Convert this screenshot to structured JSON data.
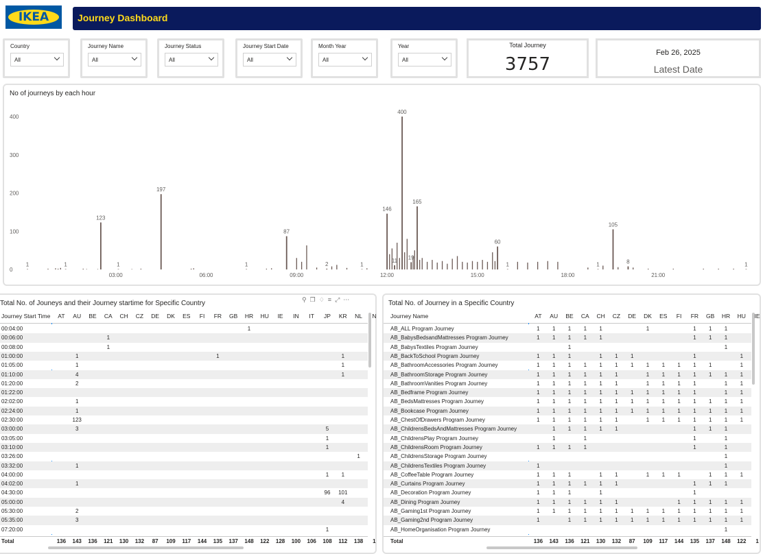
{
  "header": {
    "logo_text": "IKEA",
    "title": "Journey Dashboard"
  },
  "filters": [
    {
      "label": "Country",
      "value": "All"
    },
    {
      "label": "Journey Name",
      "value": "All"
    },
    {
      "label": "Journey Status",
      "value": "All"
    },
    {
      "label": "Journey Start Date",
      "value": "All"
    },
    {
      "label": "Month Year",
      "value": "All"
    },
    {
      "label": "Year",
      "value": "All"
    }
  ],
  "total_card": {
    "title": "Total Journey",
    "value": "3757"
  },
  "date_card": {
    "date": "Feb 26, 2025",
    "label": "Latest Date"
  },
  "colors": {
    "header_bg": "#0a1a5c",
    "header_text": "#ffda1a",
    "logo_blue": "#0058a3",
    "logo_yellow": "#ffda1a",
    "bar": "#6b5a55"
  },
  "chart_data": {
    "type": "bar",
    "title": "No of journeys by each hour",
    "x_tick_labels": [
      "03:00",
      "06:00",
      "09:00",
      "12:00",
      "15:00",
      "18:00",
      "21:00"
    ],
    "y_tick_labels": [
      "0",
      "100",
      "200",
      "300",
      "400"
    ],
    "ylim": [
      0,
      400
    ],
    "x_range_hours": [
      0,
      24
    ],
    "labeled_bars": [
      {
        "x": "00:04",
        "value": 1
      },
      {
        "x": "01:20",
        "value": 1
      },
      {
        "x": "02:30",
        "value": 123
      },
      {
        "x": "03:05",
        "value": 1
      },
      {
        "x": "04:30",
        "value": 197
      },
      {
        "x": "07:20",
        "value": 1
      },
      {
        "x": "08:40",
        "value": 87
      },
      {
        "x": "10:00",
        "value": 2
      },
      {
        "x": "11:10",
        "value": 1
      },
      {
        "x": "12:00",
        "value": 146
      },
      {
        "x": "12:15",
        "value": 11
      },
      {
        "x": "12:30",
        "value": 400
      },
      {
        "x": "12:48",
        "value": 19
      },
      {
        "x": "13:00",
        "value": 165
      },
      {
        "x": "15:40",
        "value": 60
      },
      {
        "x": "16:00",
        "value": 1
      },
      {
        "x": "19:00",
        "value": 1
      },
      {
        "x": "19:30",
        "value": 105
      },
      {
        "x": "20:00",
        "value": 8
      },
      {
        "x": "23:55",
        "value": 1
      }
    ],
    "other_bars": [
      {
        "x": "00:45",
        "value": 2
      },
      {
        "x": "01:00",
        "value": 3
      },
      {
        "x": "01:05",
        "value": 2
      },
      {
        "x": "01:10",
        "value": 4
      },
      {
        "x": "01:55",
        "value": 2
      },
      {
        "x": "02:02",
        "value": 1
      },
      {
        "x": "02:24",
        "value": 1
      },
      {
        "x": "03:32",
        "value": 1
      },
      {
        "x": "03:50",
        "value": 2
      },
      {
        "x": "05:35",
        "value": 3
      },
      {
        "x": "05:30",
        "value": 2
      },
      {
        "x": "08:00",
        "value": 2
      },
      {
        "x": "08:10",
        "value": 3
      },
      {
        "x": "09:00",
        "value": 30
      },
      {
        "x": "09:10",
        "value": 20
      },
      {
        "x": "09:20",
        "value": 63
      },
      {
        "x": "09:40",
        "value": 5
      },
      {
        "x": "10:10",
        "value": 8
      },
      {
        "x": "10:20",
        "value": 12
      },
      {
        "x": "10:40",
        "value": 4
      },
      {
        "x": "11:20",
        "value": 3
      },
      {
        "x": "12:05",
        "value": 40
      },
      {
        "x": "12:10",
        "value": 55
      },
      {
        "x": "12:20",
        "value": 70
      },
      {
        "x": "12:25",
        "value": 30
      },
      {
        "x": "12:35",
        "value": 45
      },
      {
        "x": "12:40",
        "value": 80
      },
      {
        "x": "12:52",
        "value": 35
      },
      {
        "x": "12:55",
        "value": 50
      },
      {
        "x": "13:05",
        "value": 25
      },
      {
        "x": "13:10",
        "value": 30
      },
      {
        "x": "13:20",
        "value": 20
      },
      {
        "x": "13:30",
        "value": 25
      },
      {
        "x": "13:40",
        "value": 18
      },
      {
        "x": "13:50",
        "value": 22
      },
      {
        "x": "14:00",
        "value": 15
      },
      {
        "x": "14:10",
        "value": 28
      },
      {
        "x": "14:20",
        "value": 35
      },
      {
        "x": "14:30",
        "value": 20
      },
      {
        "x": "14:40",
        "value": 18
      },
      {
        "x": "14:50",
        "value": 22
      },
      {
        "x": "15:00",
        "value": 20
      },
      {
        "x": "15:10",
        "value": 25
      },
      {
        "x": "15:20",
        "value": 20
      },
      {
        "x": "15:30",
        "value": 45
      },
      {
        "x": "15:35",
        "value": 22
      },
      {
        "x": "16:20",
        "value": 20
      },
      {
        "x": "16:40",
        "value": 18
      },
      {
        "x": "17:00",
        "value": 20
      },
      {
        "x": "17:20",
        "value": 22
      },
      {
        "x": "17:40",
        "value": 20
      },
      {
        "x": "18:40",
        "value": 5
      },
      {
        "x": "19:10",
        "value": 10
      },
      {
        "x": "19:40",
        "value": 6
      },
      {
        "x": "20:10",
        "value": 5
      },
      {
        "x": "20:40",
        "value": 2
      },
      {
        "x": "21:30",
        "value": 2
      },
      {
        "x": "22:30",
        "value": 2
      },
      {
        "x": "23:00",
        "value": 2
      },
      {
        "x": "23:30",
        "value": 2
      }
    ]
  },
  "left_table": {
    "title": "Total No. of Jouneys and their Journey startime for Specific Country",
    "row_header": "Journey Start Time",
    "columns": [
      "AT",
      "AU",
      "BE",
      "CA",
      "CH",
      "CZ",
      "DE",
      "DK",
      "ES",
      "FI",
      "FR",
      "GB",
      "HR",
      "HU",
      "IE",
      "IN",
      "IT",
      "JP",
      "KR",
      "NL",
      "N"
    ],
    "rows": [
      {
        "label": "00:04:00",
        "cells": {
          "HR": "1"
        }
      },
      {
        "label": "00:06:00",
        "cells": {
          "CA": "1"
        }
      },
      {
        "label": "00:08:00",
        "cells": {
          "CA": "1"
        }
      },
      {
        "label": "01:00:00",
        "cells": {
          "AU": "1",
          "FR": "1",
          "KR": "1"
        }
      },
      {
        "label": "01:05:00",
        "cells": {
          "AU": "1",
          "KR": "1"
        }
      },
      {
        "label": "01:10:00",
        "cells": {
          "AU": "4",
          "KR": "1"
        }
      },
      {
        "label": "01:20:00",
        "cells": {
          "AU": "2"
        }
      },
      {
        "label": "01:22:00",
        "cells": {}
      },
      {
        "label": "02:02:00",
        "cells": {
          "AU": "1"
        }
      },
      {
        "label": "02:24:00",
        "cells": {
          "AU": "1"
        }
      },
      {
        "label": "02:30:00",
        "cells": {
          "AU": "123"
        }
      },
      {
        "label": "03:00:00",
        "cells": {
          "AU": "3",
          "JP": "5"
        }
      },
      {
        "label": "03:05:00",
        "cells": {
          "JP": "1"
        }
      },
      {
        "label": "03:10:00",
        "cells": {
          "JP": "1"
        }
      },
      {
        "label": "03:26:00",
        "cells": {
          "NL": "1"
        }
      },
      {
        "label": "03:32:00",
        "cells": {
          "AU": "1"
        }
      },
      {
        "label": "04:00:00",
        "cells": {
          "JP": "1",
          "KR": "1"
        }
      },
      {
        "label": "04:02:00",
        "cells": {
          "AU": "1"
        }
      },
      {
        "label": "04:30:00",
        "cells": {
          "JP": "96",
          "KR": "101"
        }
      },
      {
        "label": "05:00:00",
        "cells": {
          "KR": "4"
        }
      },
      {
        "label": "05:30:00",
        "cells": {
          "AU": "2"
        }
      },
      {
        "label": "05:35:00",
        "cells": {
          "AU": "3"
        }
      },
      {
        "label": "07:20:00",
        "cells": {
          "JP": "1"
        }
      }
    ],
    "total_label": "Total",
    "totals": [
      "136",
      "143",
      "136",
      "121",
      "130",
      "132",
      "87",
      "109",
      "117",
      "144",
      "135",
      "137",
      "148",
      "122",
      "128",
      "100",
      "106",
      "108",
      "112",
      "138",
      "1"
    ]
  },
  "right_table": {
    "title": "Total No. of Journey in a Specific Country",
    "row_header": "Journey Name",
    "columns": [
      "AT",
      "AU",
      "BE",
      "CA",
      "CH",
      "CZ",
      "DE",
      "DK",
      "ES",
      "FI",
      "FR",
      "GB",
      "HR",
      "HU",
      "IE"
    ],
    "rows": [
      {
        "label": "AB_ALL Program Journey",
        "cells": [
          "1",
          "1",
          "1",
          "1",
          "1",
          "",
          "",
          "1",
          "",
          "",
          "1",
          "1",
          "1",
          "",
          ""
        ]
      },
      {
        "label": "AB_BabysBedsandMattresses Program Journey",
        "cells": [
          "1",
          "1",
          "1",
          "1",
          "1",
          "",
          "",
          "",
          "",
          "",
          "1",
          "1",
          "1",
          "",
          ""
        ]
      },
      {
        "label": "AB_BabysTextiles Program Journey",
        "cells": [
          "",
          "",
          "1",
          "",
          "",
          "",
          "",
          "",
          "",
          "",
          "",
          "",
          "1",
          "",
          ""
        ]
      },
      {
        "label": "AB_BackToSchool Program Journey",
        "cells": [
          "1",
          "1",
          "1",
          "",
          "1",
          "1",
          "1",
          "",
          "",
          "",
          "1",
          "",
          "",
          "1",
          ""
        ]
      },
      {
        "label": "AB_BathroomAccessories Program Journey",
        "cells": [
          "1",
          "1",
          "1",
          "1",
          "1",
          "1",
          "1",
          "1",
          "1",
          "1",
          "1",
          "1",
          "",
          "1",
          ""
        ]
      },
      {
        "label": "AB_BathroomStorage Program Journey",
        "cells": [
          "1",
          "1",
          "1",
          "1",
          "1",
          "1",
          "",
          "1",
          "1",
          "1",
          "1",
          "1",
          "1",
          "1",
          ""
        ]
      },
      {
        "label": "AB_BathroomVanities Program Journey",
        "cells": [
          "1",
          "1",
          "1",
          "1",
          "1",
          "1",
          "",
          "1",
          "1",
          "1",
          "1",
          "",
          "1",
          "1",
          ""
        ]
      },
      {
        "label": "AB_Bedframe Program Journey",
        "cells": [
          "1",
          "1",
          "1",
          "1",
          "1",
          "1",
          "1",
          "1",
          "1",
          "1",
          "1",
          "",
          "1",
          "1",
          ""
        ]
      },
      {
        "label": "AB_BedsMattresses Program Journey",
        "cells": [
          "1",
          "1",
          "1",
          "1",
          "1",
          "1",
          "1",
          "1",
          "1",
          "1",
          "1",
          "1",
          "1",
          "1",
          ""
        ]
      },
      {
        "label": "AB_Bookcase Program Journey",
        "cells": [
          "1",
          "1",
          "1",
          "1",
          "1",
          "1",
          "1",
          "1",
          "1",
          "1",
          "1",
          "1",
          "1",
          "1",
          ""
        ]
      },
      {
        "label": "AB_ChestOfDrawers Program Journey",
        "cells": [
          "1",
          "1",
          "1",
          "1",
          "1",
          "1",
          "",
          "1",
          "1",
          "1",
          "1",
          "1",
          "1",
          "1",
          ""
        ]
      },
      {
        "label": "AB_ChildrensBedsAndMattresses Program Journey",
        "cells": [
          "",
          "1",
          "1",
          "1",
          "1",
          "1",
          "",
          "",
          "",
          "",
          "1",
          "1",
          "1",
          "",
          ""
        ]
      },
      {
        "label": "AB_ChildrensPlay Program Journey",
        "cells": [
          "",
          "1",
          "",
          "1",
          "",
          "",
          "",
          "",
          "",
          "",
          "1",
          "",
          "1",
          "",
          ""
        ]
      },
      {
        "label": "AB_ChildrensRoom Program Journey",
        "cells": [
          "1",
          "1",
          "1",
          "1",
          "",
          "",
          "",
          "",
          "",
          "",
          "1",
          "",
          "1",
          "",
          ""
        ]
      },
      {
        "label": "AB_ChildrensStorage Program Journey",
        "cells": [
          "",
          "",
          "",
          "",
          "",
          "",
          "",
          "",
          "",
          "",
          "",
          "",
          "1",
          "",
          ""
        ]
      },
      {
        "label": "AB_ChildrensTextiles Program Journey",
        "cells": [
          "1",
          "",
          "",
          "",
          "",
          "",
          "",
          "",
          "",
          "",
          "",
          "",
          "1",
          "",
          ""
        ]
      },
      {
        "label": "AB_CoffeeTable Program Journey",
        "cells": [
          "1",
          "1",
          "1",
          "",
          "1",
          "1",
          "",
          "1",
          "1",
          "1",
          "",
          "1",
          "1",
          "1",
          ""
        ]
      },
      {
        "label": "AB_Curtains Program Journey",
        "cells": [
          "1",
          "1",
          "1",
          "1",
          "1",
          "1",
          "",
          "",
          "",
          "",
          "1",
          "1",
          "1",
          "",
          ""
        ]
      },
      {
        "label": "AB_Decoration Program Journey",
        "cells": [
          "1",
          "1",
          "1",
          "",
          "1",
          "",
          "",
          "",
          "",
          "",
          "1",
          "",
          "",
          "",
          ""
        ]
      },
      {
        "label": "AB_Dining Program Journey",
        "cells": [
          "1",
          "1",
          "1",
          "1",
          "1",
          "1",
          "",
          "",
          "",
          "1",
          "1",
          "1",
          "1",
          "1",
          ""
        ]
      },
      {
        "label": "AB_Gaming1st Program Journey",
        "cells": [
          "1",
          "1",
          "1",
          "1",
          "1",
          "1",
          "1",
          "1",
          "1",
          "1",
          "1",
          "1",
          "1",
          "1",
          ""
        ]
      },
      {
        "label": "AB_Gaming2nd Program Journey",
        "cells": [
          "1",
          "",
          "1",
          "1",
          "1",
          "1",
          "1",
          "1",
          "1",
          "1",
          "1",
          "1",
          "1",
          "1",
          ""
        ]
      },
      {
        "label": "AB_HomeOrganisation Program Journey",
        "cells": [
          "",
          "",
          "",
          "",
          "",
          "",
          "",
          "",
          "",
          "",
          "",
          "",
          "1",
          "",
          ""
        ]
      }
    ],
    "total_label": "Total",
    "totals": [
      "136",
      "143",
      "136",
      "121",
      "130",
      "132",
      "87",
      "109",
      "117",
      "144",
      "135",
      "137",
      "148",
      "122",
      "1"
    ]
  }
}
